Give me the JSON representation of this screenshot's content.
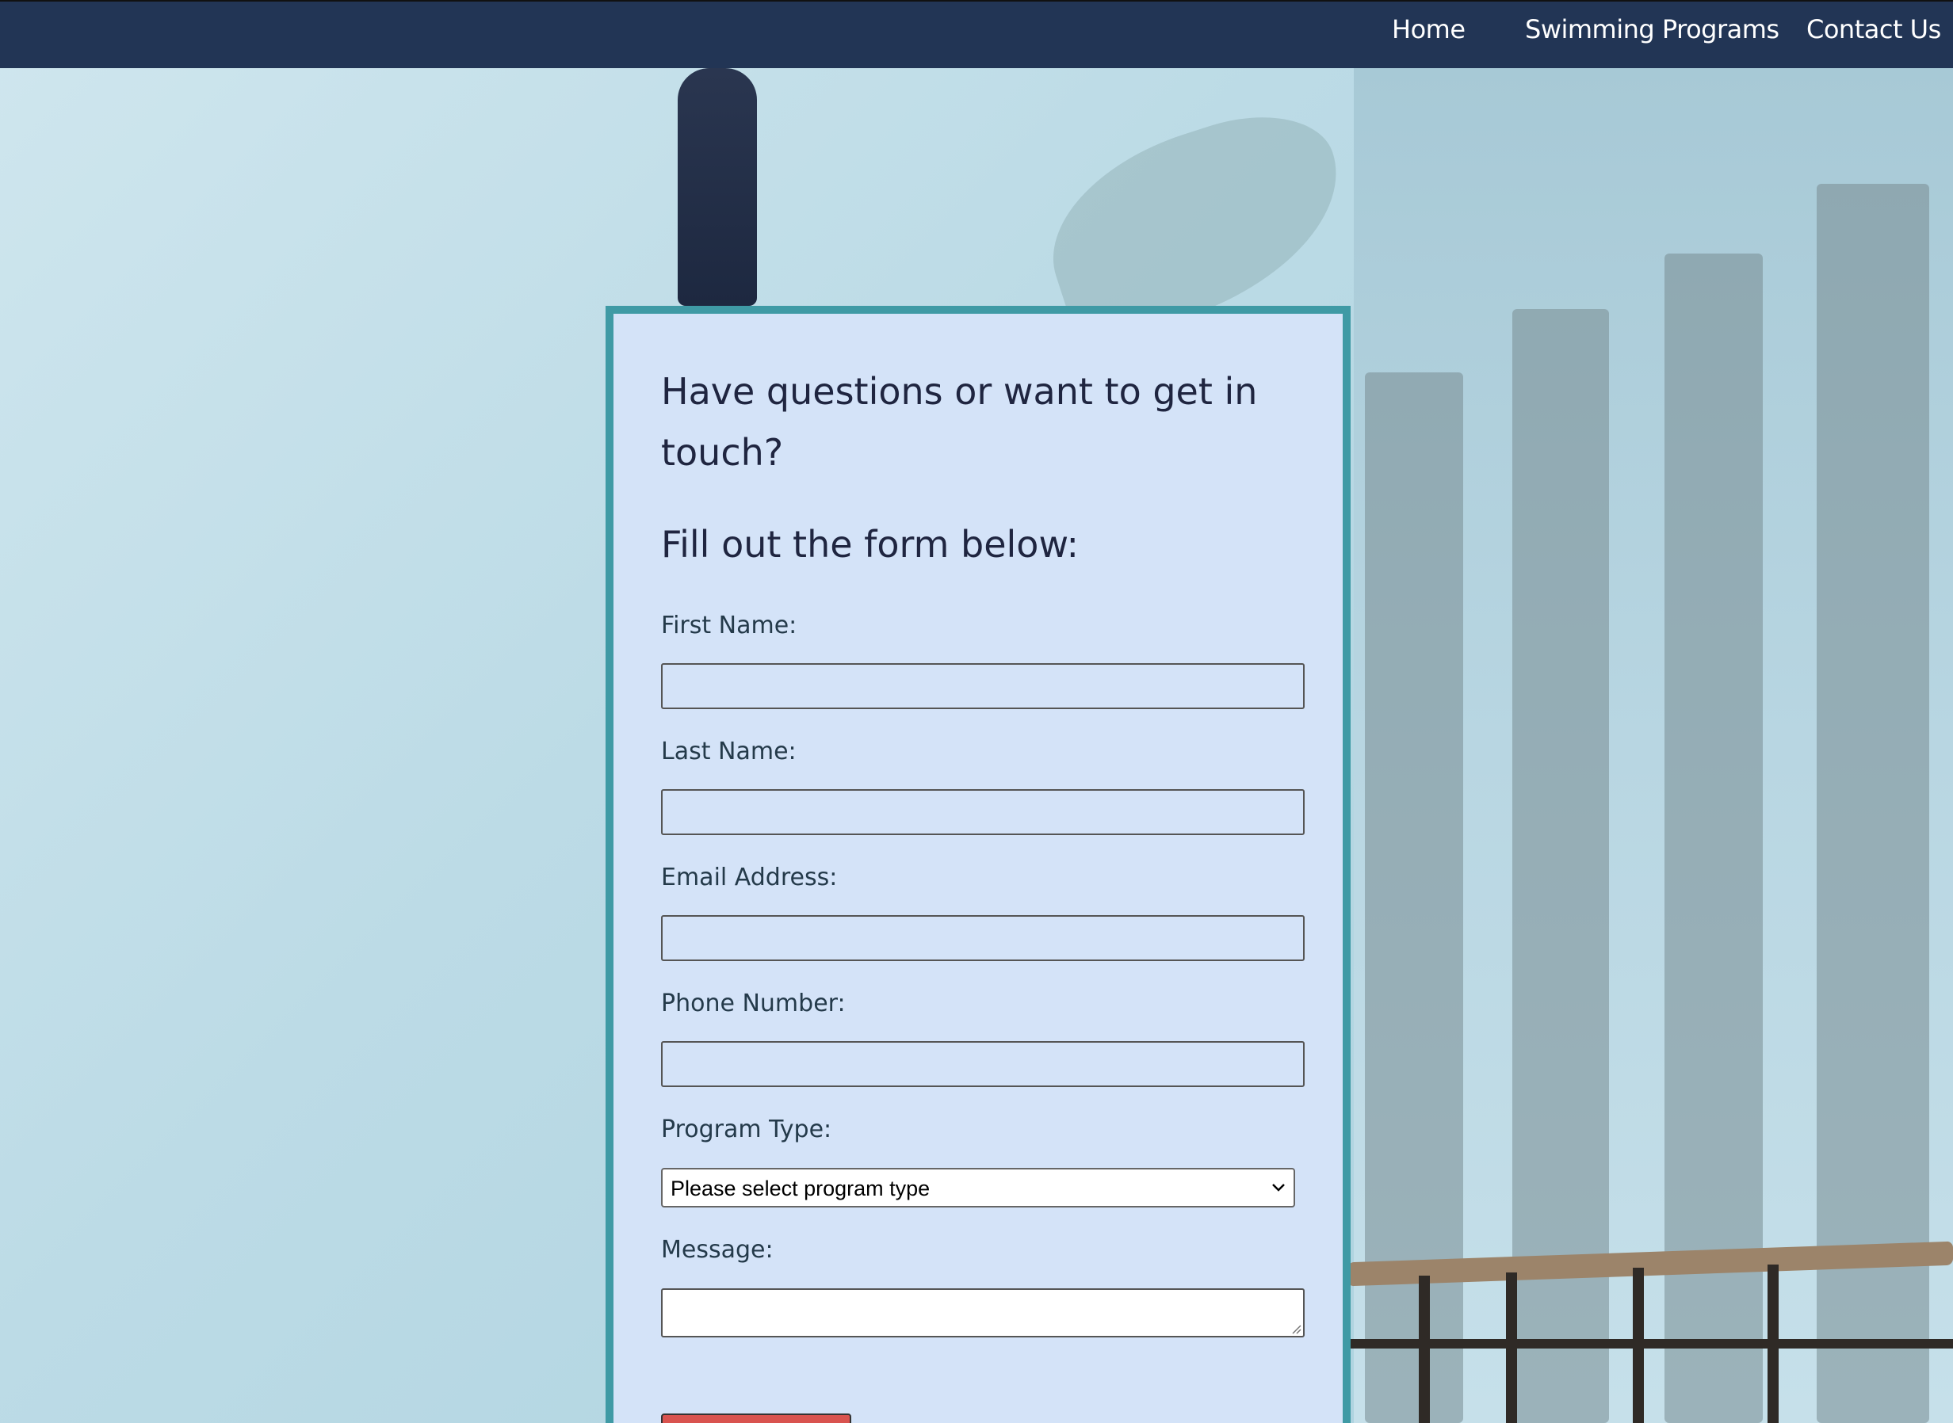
{
  "nav": {
    "items": [
      {
        "label": "Home"
      },
      {
        "label": "Swimming Programs"
      },
      {
        "label": "Contact Us"
      }
    ]
  },
  "form": {
    "heading": "Have questions or want to get in touch?",
    "subheading": "Fill out the form below:",
    "fields": {
      "first_name": {
        "label": "First Name:",
        "value": ""
      },
      "last_name": {
        "label": "Last Name:",
        "value": ""
      },
      "email": {
        "label": "Email Address:",
        "value": ""
      },
      "phone": {
        "label": "Phone Number:",
        "value": ""
      },
      "program_type": {
        "label": "Program Type:",
        "selected": "Please select program type"
      },
      "message": {
        "label": "Message:",
        "value": ""
      }
    }
  },
  "colors": {
    "nav_bg": "#223555",
    "card_bg": "#d4e3f8",
    "card_border": "#3f9aa5",
    "submit_button": "#d9534f"
  }
}
